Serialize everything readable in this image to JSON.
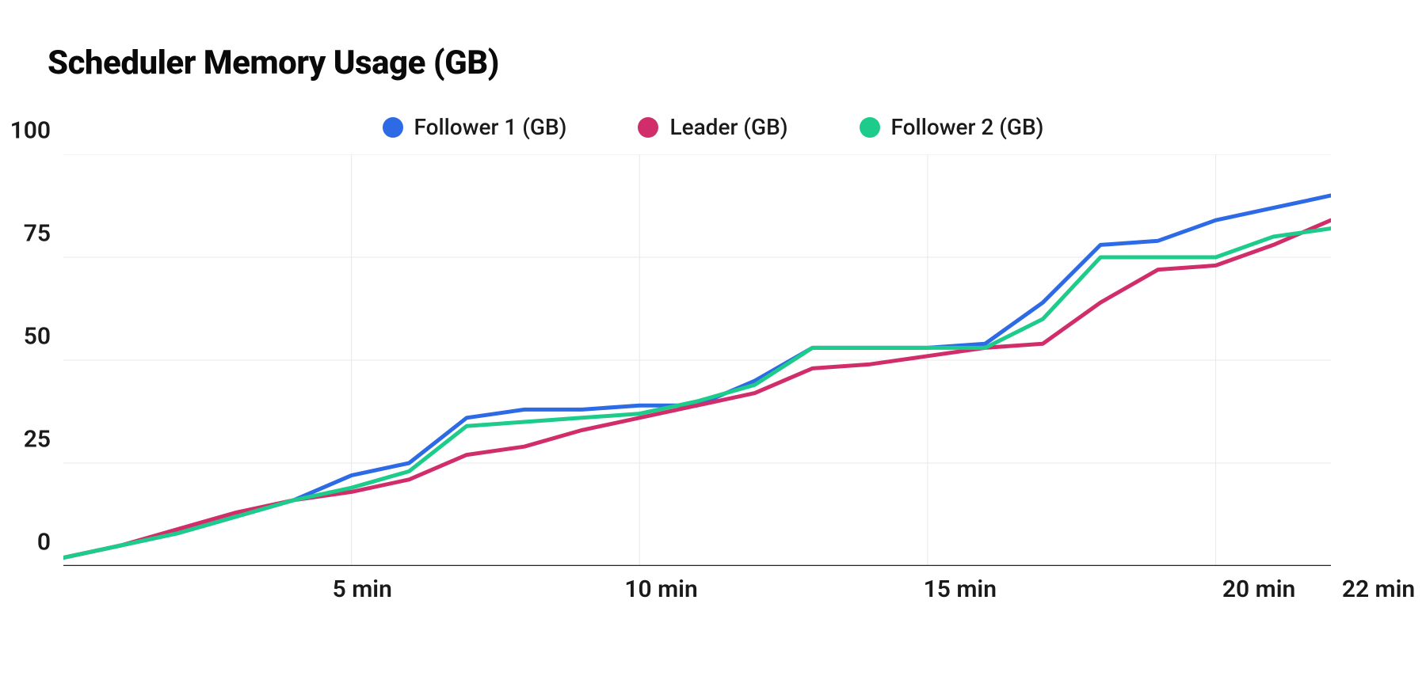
{
  "title": "Scheduler Memory Usage (GB)",
  "legend": [
    {
      "label": "Follower 1 (GB)",
      "color": "#2d6ae6"
    },
    {
      "label": "Leader (GB)",
      "color": "#d12d6b"
    },
    {
      "label": "Follower 2 (GB)",
      "color": "#1dcb8b"
    }
  ],
  "y_ticks": [
    "0",
    "25",
    "50",
    "75",
    "100"
  ],
  "x_ticks": [
    {
      "label": "5 min",
      "value": 5
    },
    {
      "label": "10 min",
      "value": 10
    },
    {
      "label": "15 min",
      "value": 15
    },
    {
      "label": "20 min",
      "value": 20
    },
    {
      "label": "22 min",
      "value": 22
    }
  ],
  "chart_data": {
    "type": "line",
    "title": "Scheduler Memory Usage (GB)",
    "xlabel": "",
    "ylabel": "",
    "xlim": [
      0,
      22
    ],
    "ylim": [
      0,
      100
    ],
    "x": [
      0,
      1,
      2,
      3,
      4,
      5,
      6,
      7,
      8,
      9,
      10,
      11,
      12,
      13,
      14,
      15,
      16,
      17,
      18,
      19,
      20,
      21,
      22
    ],
    "series": [
      {
        "name": "Follower 1 (GB)",
        "color": "#2d6ae6",
        "values": [
          2,
          5,
          8,
          12,
          16,
          22,
          25,
          36,
          38,
          38,
          39,
          39,
          45,
          53,
          53,
          53,
          54,
          64,
          78,
          79,
          84,
          87,
          90
        ]
      },
      {
        "name": "Leader (GB)",
        "color": "#d12d6b",
        "values": [
          2,
          5,
          9,
          13,
          16,
          18,
          21,
          27,
          29,
          33,
          36,
          39,
          42,
          48,
          49,
          51,
          53,
          54,
          64,
          72,
          73,
          78,
          84
        ]
      },
      {
        "name": "Follower 2 (GB)",
        "color": "#1dcb8b",
        "values": [
          2,
          5,
          8,
          12,
          16,
          19,
          23,
          34,
          35,
          36,
          37,
          40,
          44,
          53,
          53,
          53,
          53,
          60,
          75,
          75,
          75,
          80,
          82
        ]
      }
    ],
    "legend_position": "top",
    "grid": true
  }
}
